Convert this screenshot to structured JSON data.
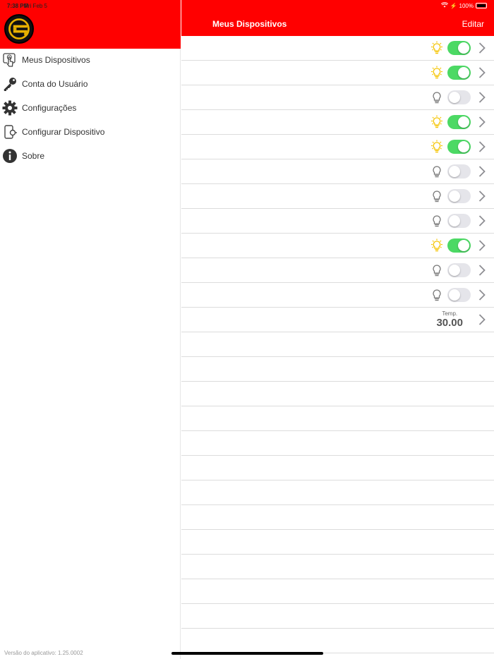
{
  "status_bar": {
    "time": "7:38 PM",
    "date": "Fri Feb 5",
    "battery": "100%"
  },
  "sidebar": {
    "menu": [
      {
        "label": "Meus Dispositivos",
        "icon": "touch-icon"
      },
      {
        "label": "Conta do Usuário",
        "icon": "key-icon"
      },
      {
        "label": "Configurações",
        "icon": "gear-icon"
      },
      {
        "label": "Configurar Dispositivo",
        "icon": "device-setup-icon"
      },
      {
        "label": "Sobre",
        "icon": "info-icon"
      }
    ],
    "version": "Versão do aplicativo: 1.25.0002"
  },
  "nav": {
    "title": "Meus Dispositivos",
    "edit_label": "Editar"
  },
  "devices": [
    {
      "type": "light",
      "on": true
    },
    {
      "type": "light",
      "on": true
    },
    {
      "type": "light",
      "on": false
    },
    {
      "type": "light",
      "on": true
    },
    {
      "type": "light",
      "on": true
    },
    {
      "type": "light",
      "on": false
    },
    {
      "type": "light",
      "on": false
    },
    {
      "type": "light",
      "on": false
    },
    {
      "type": "light",
      "on": true
    },
    {
      "type": "light",
      "on": false
    },
    {
      "type": "light",
      "on": false
    },
    {
      "type": "temperature",
      "label": "Temp.",
      "value": "30.00"
    }
  ],
  "colors": {
    "header": "#ff0000",
    "toggle_on": "#4cd964",
    "bulb_on": "#f5c400",
    "bulb_off": "#777777"
  }
}
